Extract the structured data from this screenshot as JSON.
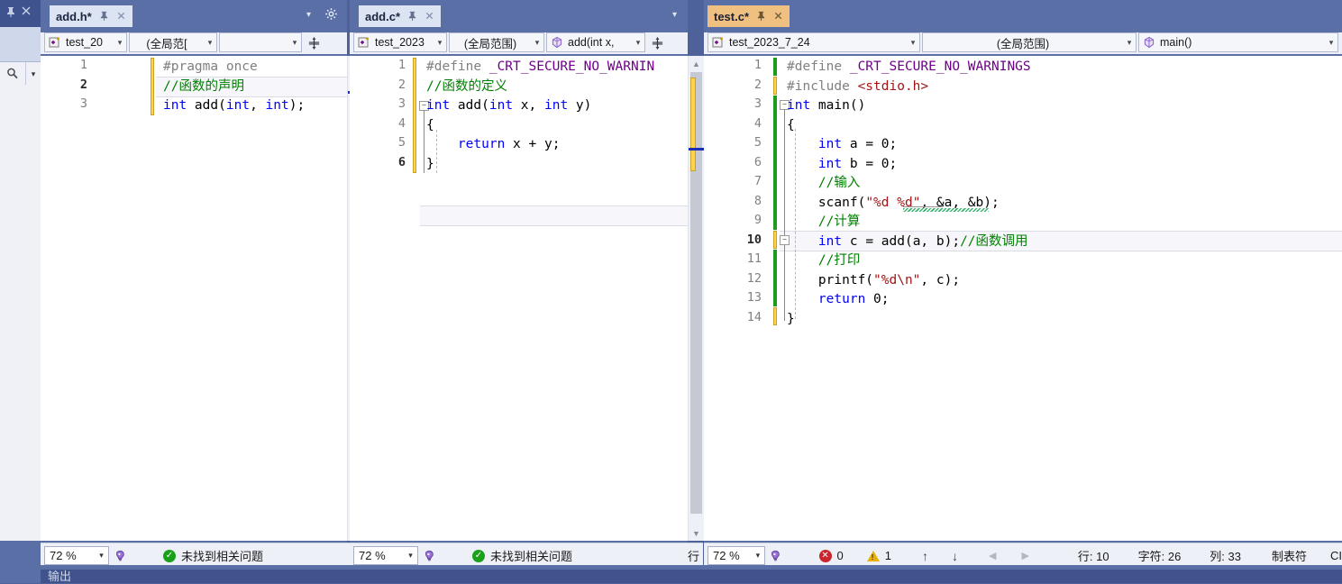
{
  "app": {
    "theme_bg": "#4e6199",
    "accent": "#f0c080"
  },
  "left_dock": {
    "pin_icon": "pin-icon",
    "close_icon": "close-icon",
    "search_icon": "search-icon",
    "dropdown_icon": "chevron-down-icon"
  },
  "panes": [
    {
      "id": "pane-add-h",
      "tab": {
        "label": "add.h*",
        "pin_glyph": "⌐",
        "close_glyph": "✕",
        "active": false
      },
      "navbar": {
        "project": "test_20",
        "scope": "(全局范[",
        "member": "",
        "project_icon": "cpp-project-icon",
        "member_icon": "",
        "split_icon": "split-horizontal-icon",
        "arrow_glyph": "▾"
      },
      "zoom": "72 %",
      "status": {
        "text": "未找到相关问题",
        "icon": "ok-circle-icon",
        "head_icon": "intellicode-icon"
      },
      "lines": [
        {
          "n": 1,
          "tokens": [
            {
              "t": "#pragma once",
              "c": "pp"
            }
          ]
        },
        {
          "n": 2,
          "tokens": [
            {
              "t": "//函数的声明",
              "c": "cmt"
            }
          ]
        },
        {
          "n": 3,
          "tokens": [
            {
              "t": "int",
              "c": "kw"
            },
            {
              "t": " add(",
              "c": "pln"
            },
            {
              "t": "int",
              "c": "kw"
            },
            {
              "t": ", ",
              "c": "pln"
            },
            {
              "t": "int",
              "c": "kw"
            },
            {
              "t": ");",
              "c": "pln"
            }
          ]
        }
      ],
      "current_line": 2,
      "scrollbar": {
        "up_glyph": "▲",
        "down_glyph": "▼"
      }
    },
    {
      "id": "pane-add-c",
      "tab": {
        "label": "add.c*",
        "pin_glyph": "⌐",
        "close_glyph": "✕",
        "active": false
      },
      "navbar": {
        "project": "test_2023",
        "scope": "(全局范围)",
        "member": "add(int x,",
        "project_icon": "cpp-project-icon",
        "member_icon": "method-cube-icon",
        "split_icon": "split-horizontal-icon",
        "arrow_glyph": "▾"
      },
      "zoom": "72 %",
      "status": {
        "text": "未找到相关问题",
        "icon": "ok-circle-icon",
        "head_icon": "intellicode-icon",
        "trailing": "行"
      },
      "lines": [
        {
          "n": 1,
          "tokens": [
            {
              "t": "#define ",
              "c": "pp"
            },
            {
              "t": "_CRT_SECURE_NO_WARNIN",
              "c": "mac"
            }
          ]
        },
        {
          "n": 2,
          "tokens": [
            {
              "t": "//函数的定义",
              "c": "cmt"
            }
          ]
        },
        {
          "n": 3,
          "tokens": [
            {
              "t": "int",
              "c": "kw"
            },
            {
              "t": " add(",
              "c": "pln"
            },
            {
              "t": "int",
              "c": "kw"
            },
            {
              "t": " x, ",
              "c": "pln"
            },
            {
              "t": "int",
              "c": "kw"
            },
            {
              "t": " y)",
              "c": "pln"
            }
          ]
        },
        {
          "n": 4,
          "tokens": [
            {
              "t": "{",
              "c": "pln"
            }
          ]
        },
        {
          "n": 5,
          "tokens": [
            {
              "t": "    ",
              "c": "pln"
            },
            {
              "t": "return",
              "c": "kw"
            },
            {
              "t": " x + y;",
              "c": "pln"
            }
          ]
        },
        {
          "n": 6,
          "tokens": [
            {
              "t": "}",
              "c": "pln"
            }
          ]
        }
      ],
      "current_line": 6,
      "scrollbar": {
        "up_glyph": "▲",
        "down_glyph": "▼"
      }
    },
    {
      "id": "pane-test-c",
      "tab": {
        "label": "test.c*",
        "pin_glyph": "⌐",
        "close_glyph": "✕",
        "active": true
      },
      "navbar": {
        "project": "test_2023_7_24",
        "scope": "(全局范围)",
        "member": "main()",
        "project_icon": "cpp-project-icon",
        "member_icon": "method-cube-icon",
        "split_icon": "",
        "arrow_glyph": "▾"
      },
      "zoom": "72 %",
      "status": {
        "head_icon": "intellicode-icon",
        "errors": "0",
        "warnings": "1",
        "up_glyph": "↑",
        "down_glyph": "↓",
        "back_glyph": "◀",
        "forward_glyph": "▶",
        "line_label": "行: 10",
        "char_label": "字符: 26",
        "col_label": "列: 33",
        "tab_mode": "制表符",
        "encoding": "CI"
      },
      "lines": [
        {
          "n": 1,
          "tokens": [
            {
              "t": "#define ",
              "c": "pp"
            },
            {
              "t": "_CRT_SECURE_NO_WARNINGS",
              "c": "mac"
            }
          ]
        },
        {
          "n": 2,
          "tokens": [
            {
              "t": "#include ",
              "c": "pp"
            },
            {
              "t": "<stdio.h>",
              "c": "str"
            }
          ]
        },
        {
          "n": 3,
          "tokens": [
            {
              "t": "int",
              "c": "kw"
            },
            {
              "t": " main()",
              "c": "pln"
            }
          ]
        },
        {
          "n": 4,
          "tokens": [
            {
              "t": "{",
              "c": "pln"
            }
          ]
        },
        {
          "n": 5,
          "tokens": [
            {
              "t": "    ",
              "c": "pln"
            },
            {
              "t": "int",
              "c": "kw"
            },
            {
              "t": " a = 0;",
              "c": "pln"
            }
          ]
        },
        {
          "n": 6,
          "tokens": [
            {
              "t": "    ",
              "c": "pln"
            },
            {
              "t": "int",
              "c": "kw"
            },
            {
              "t": " b = 0;",
              "c": "pln"
            }
          ]
        },
        {
          "n": 7,
          "tokens": [
            {
              "t": "    ",
              "c": "pln"
            },
            {
              "t": "//输入",
              "c": "cmt"
            }
          ]
        },
        {
          "n": 8,
          "tokens": [
            {
              "t": "    scanf(",
              "c": "pln"
            },
            {
              "t": "\"%d %d\"",
              "c": "str"
            },
            {
              "t": ", &a, &b);",
              "c": "pln"
            }
          ]
        },
        {
          "n": 9,
          "tokens": [
            {
              "t": "    ",
              "c": "pln"
            },
            {
              "t": "//计算",
              "c": "cmt"
            }
          ]
        },
        {
          "n": 10,
          "tokens": [
            {
              "t": "    ",
              "c": "pln"
            },
            {
              "t": "int",
              "c": "kw"
            },
            {
              "t": " c = add(a, b);",
              "c": "pln"
            },
            {
              "t": "//函数调用",
              "c": "cmt"
            }
          ]
        },
        {
          "n": 11,
          "tokens": [
            {
              "t": "    ",
              "c": "pln"
            },
            {
              "t": "//打印",
              "c": "cmt"
            }
          ]
        },
        {
          "n": 12,
          "tokens": [
            {
              "t": "    printf(",
              "c": "pln"
            },
            {
              "t": "\"%d\\n\"",
              "c": "str"
            },
            {
              "t": ", c);",
              "c": "pln"
            }
          ]
        },
        {
          "n": 13,
          "tokens": [
            {
              "t": "    ",
              "c": "pln"
            },
            {
              "t": "return",
              "c": "kw"
            },
            {
              "t": " 0;",
              "c": "pln"
            }
          ]
        },
        {
          "n": 14,
          "tokens": [
            {
              "t": "}",
              "c": "pln"
            }
          ]
        }
      ],
      "current_line": 10,
      "scrollbar": {
        "up_glyph": "▲",
        "down_glyph": "▼"
      }
    }
  ],
  "output_panel": {
    "tab_label": "输出"
  }
}
